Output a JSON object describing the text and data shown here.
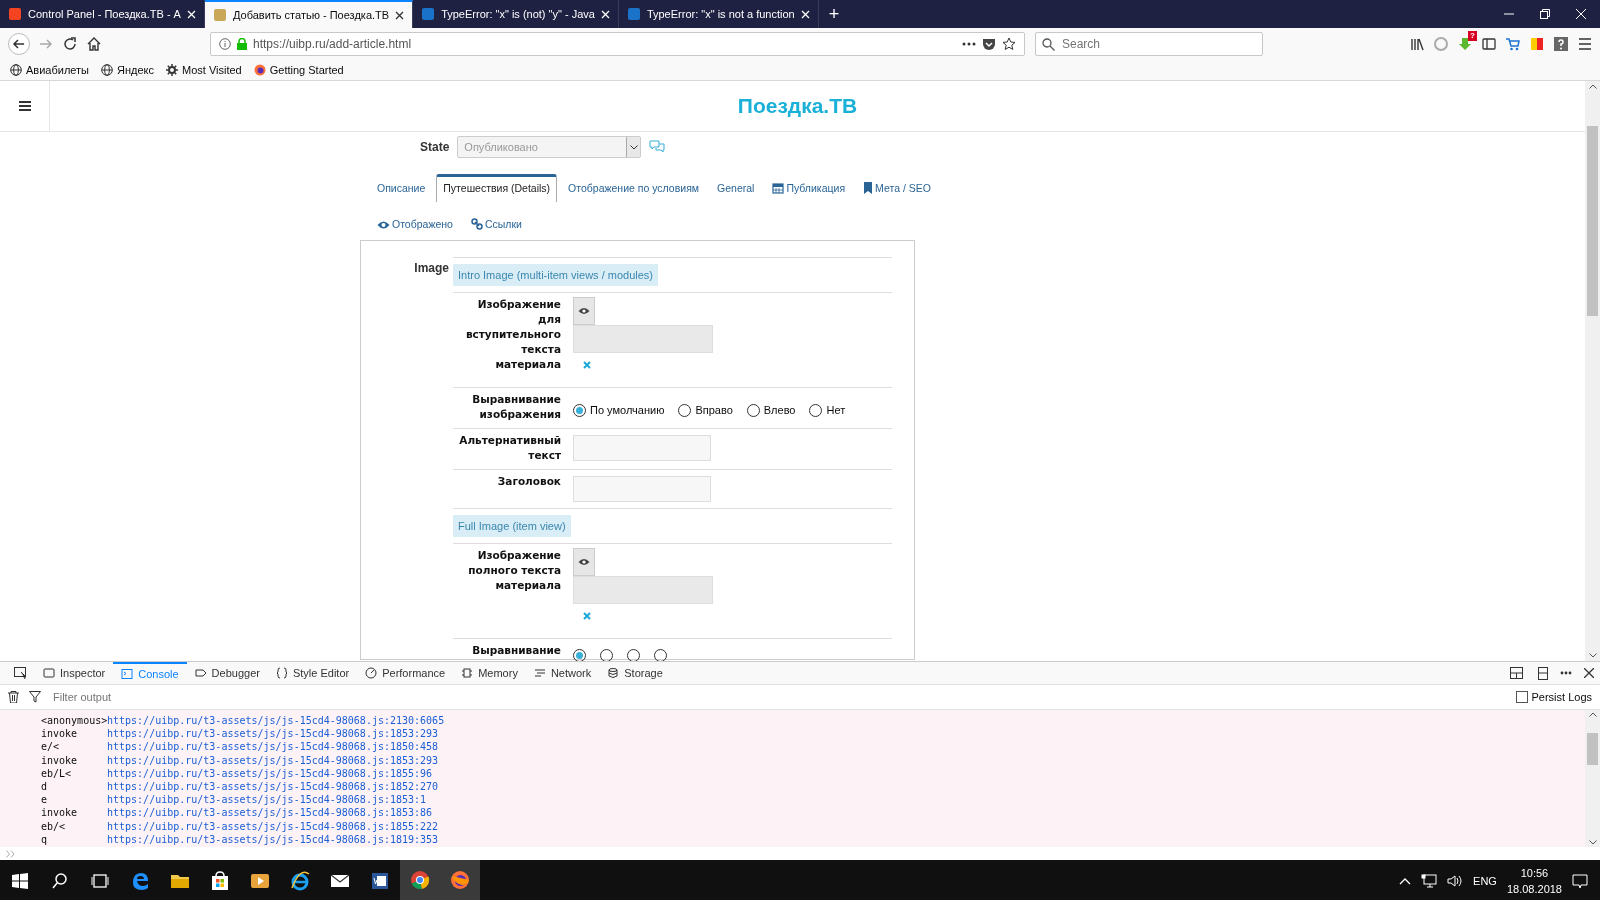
{
  "browser": {
    "tabs": [
      {
        "title": "Control Panel - Поездка.ТВ - А",
        "selected": false
      },
      {
        "title": "Добавить статью - Поездка.ТВ",
        "selected": true
      },
      {
        "title": "TypeError: \"x\" is (not) \"y\" - Java",
        "selected": false
      },
      {
        "title": "TypeError: \"x\" is not a function",
        "selected": false
      }
    ],
    "new_tab": "+",
    "url": "https://uibp.ru/add-article.html",
    "search": {
      "placeholder": "Search"
    },
    "download_badge": "?",
    "bookmarks": [
      {
        "label": "Авиабилеты",
        "kind": "globe"
      },
      {
        "label": "Яндекс",
        "kind": "globe"
      },
      {
        "label": "Most Visited",
        "kind": "gear"
      },
      {
        "label": "Getting Started",
        "kind": "firefox"
      }
    ]
  },
  "page": {
    "site_title": "Поездка.ТВ",
    "state": {
      "label": "State",
      "value": "Опубликовано"
    },
    "tabs": [
      {
        "label": "Описание",
        "kind": "plain",
        "selected": false
      },
      {
        "label": "Путешествия (Details)",
        "kind": "plain",
        "selected": true
      },
      {
        "label": "Отображение по условиям",
        "kind": "plain",
        "selected": false
      },
      {
        "label": "General",
        "kind": "plain",
        "selected": false
      },
      {
        "label": "Публикация",
        "kind": "calendar",
        "selected": false
      },
      {
        "label": "Мета / SEO",
        "kind": "bookmark",
        "selected": false
      },
      {
        "label": "Отображено",
        "kind": "eye",
        "selected": false
      },
      {
        "label": "Ссылки",
        "kind": "link",
        "selected": false
      }
    ],
    "image_label": "Image",
    "sections": [
      {
        "title": "Intro Image (multi-item views / modules)",
        "fields": [
          {
            "kind": "media",
            "label": "Изображение для вступительного текста материала"
          },
          {
            "kind": "radio",
            "label": "Выравнивание изображения",
            "options": [
              {
                "label": "По умолчанию",
                "selected": true
              },
              {
                "label": "Вправо",
                "selected": false
              },
              {
                "label": "Влево",
                "selected": false
              },
              {
                "label": "Нет",
                "selected": false
              }
            ]
          },
          {
            "kind": "text",
            "label": "Альтернативный текст"
          },
          {
            "kind": "text",
            "label": "Заголовок"
          }
        ]
      },
      {
        "title": "Full Image (item view)",
        "fields": [
          {
            "kind": "media",
            "label": "Изображение полного текста материала"
          },
          {
            "kind": "radio",
            "label": "Выравнивание",
            "options": [
              {
                "selected": true
              },
              {
                "selected": false
              },
              {
                "selected": false
              },
              {
                "selected": false
              }
            ]
          }
        ]
      }
    ]
  },
  "devtools": {
    "tabs": [
      {
        "label": "Inspector",
        "kind": "inspector",
        "selected": false
      },
      {
        "label": "Console",
        "kind": "console",
        "selected": true
      },
      {
        "label": "Debugger",
        "kind": "debugger",
        "selected": false
      },
      {
        "label": "Style Editor",
        "kind": "braces",
        "selected": false
      },
      {
        "label": "Performance",
        "kind": "gauge",
        "selected": false
      },
      {
        "label": "Memory",
        "kind": "chip",
        "selected": false
      },
      {
        "label": "Network",
        "kind": "lines",
        "selected": false
      },
      {
        "label": "Storage",
        "kind": "db",
        "selected": false
      }
    ],
    "filter": {
      "placeholder": "Filter output"
    },
    "persist_logs": {
      "label": "Persist Logs",
      "checked": false
    },
    "console_rows": [
      {
        "fn": "<anonymous>",
        "url": "https://uibp.ru/t3-assets/js/js-15cd4-98068.js:2130:6065"
      },
      {
        "fn": "invoke",
        "url": "https://uibp.ru/t3-assets/js/js-15cd4-98068.js:1853:293"
      },
      {
        "fn": "e/<",
        "url": "https://uibp.ru/t3-assets/js/js-15cd4-98068.js:1850:458"
      },
      {
        "fn": "invoke",
        "url": "https://uibp.ru/t3-assets/js/js-15cd4-98068.js:1853:293"
      },
      {
        "fn": "eb/L<",
        "url": "https://uibp.ru/t3-assets/js/js-15cd4-98068.js:1855:96"
      },
      {
        "fn": "d",
        "url": "https://uibp.ru/t3-assets/js/js-15cd4-98068.js:1852:270"
      },
      {
        "fn": "e",
        "url": "https://uibp.ru/t3-assets/js/js-15cd4-98068.js:1853:1"
      },
      {
        "fn": "invoke",
        "url": "https://uibp.ru/t3-assets/js/js-15cd4-98068.js:1853:86"
      },
      {
        "fn": "eb/<",
        "url": "https://uibp.ru/t3-assets/js/js-15cd4-98068.js:1855:222"
      },
      {
        "fn": "q",
        "url": "https://uibp.ru/t3-assets/js/js-15cd4-98068.js:1819:353"
      }
    ]
  },
  "taskbar": {
    "apps": [
      {
        "kind": "search",
        "active": false
      },
      {
        "kind": "taskview",
        "active": false
      },
      {
        "kind": "edge",
        "active": false
      },
      {
        "kind": "folder",
        "active": false
      },
      {
        "kind": "store",
        "active": false
      },
      {
        "kind": "media",
        "active": false
      },
      {
        "kind": "ie",
        "active": false
      },
      {
        "kind": "mail",
        "active": false
      },
      {
        "kind": "doc",
        "active": false
      },
      {
        "kind": "chrome",
        "active": true
      },
      {
        "kind": "firefox",
        "active": true
      }
    ],
    "language": "ENG",
    "time": "10:56",
    "date": "18.08.2018"
  }
}
